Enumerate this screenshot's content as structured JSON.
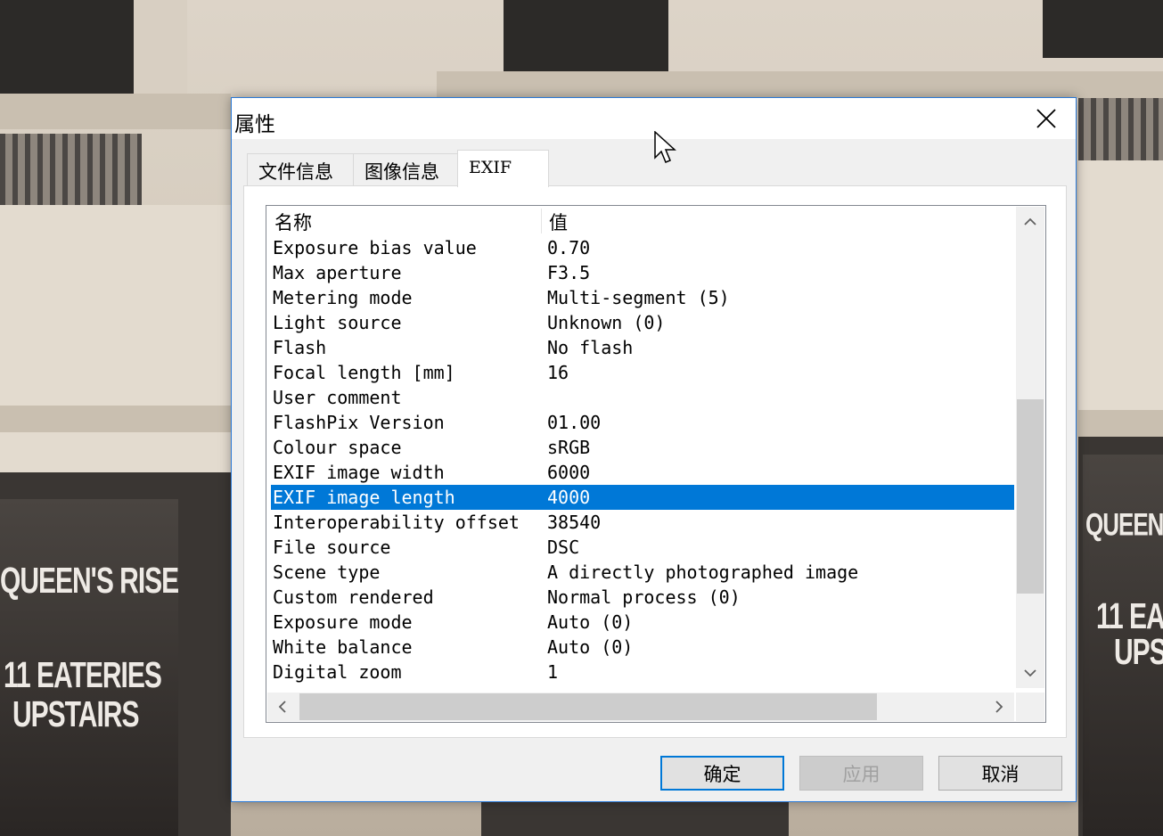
{
  "background": {
    "signs": [
      "QUEEN'S RISE",
      "11 EATERIES",
      "UPSTAIRS",
      "QUEEN",
      "11 EA",
      "UPS"
    ]
  },
  "dialog": {
    "title": "属性",
    "tabs": [
      {
        "label": "文件信息",
        "active": false
      },
      {
        "label": "图像信息",
        "active": false
      },
      {
        "label": "EXIF",
        "active": true
      }
    ],
    "list": {
      "columns": [
        "名称",
        "值"
      ],
      "rows": [
        {
          "name": "Exposure bias value",
          "value": "0.70"
        },
        {
          "name": "Max aperture",
          "value": "F3.5"
        },
        {
          "name": "Metering mode",
          "value": "Multi-segment (5)"
        },
        {
          "name": "Light source",
          "value": "Unknown (0)"
        },
        {
          "name": "Flash",
          "value": "No flash"
        },
        {
          "name": "Focal length [mm]",
          "value": "16"
        },
        {
          "name": "User comment",
          "value": ""
        },
        {
          "name": "FlashPix Version",
          "value": "01.00"
        },
        {
          "name": "Colour space",
          "value": "sRGB"
        },
        {
          "name": "EXIF image width",
          "value": "6000"
        },
        {
          "name": "EXIF image length",
          "value": "4000"
        },
        {
          "name": "Interoperability offset",
          "value": "38540"
        },
        {
          "name": "File source",
          "value": "DSC"
        },
        {
          "name": "Scene type",
          "value": "A directly photographed image"
        },
        {
          "name": "Custom rendered",
          "value": "Normal process (0)"
        },
        {
          "name": "Exposure mode",
          "value": "Auto (0)"
        },
        {
          "name": "White balance",
          "value": "Auto (0)"
        },
        {
          "name": "Digital zoom",
          "value": "1"
        }
      ],
      "selected_row": "EXIF image length",
      "vertical_scroll_fraction": 0.55,
      "horizontal_scroll_fraction": 0.0
    },
    "buttons": {
      "ok": "确定",
      "apply": "应用",
      "cancel": "取消"
    },
    "colors": {
      "selection": "#0078d7",
      "accent_border": "#2b79d6"
    }
  }
}
